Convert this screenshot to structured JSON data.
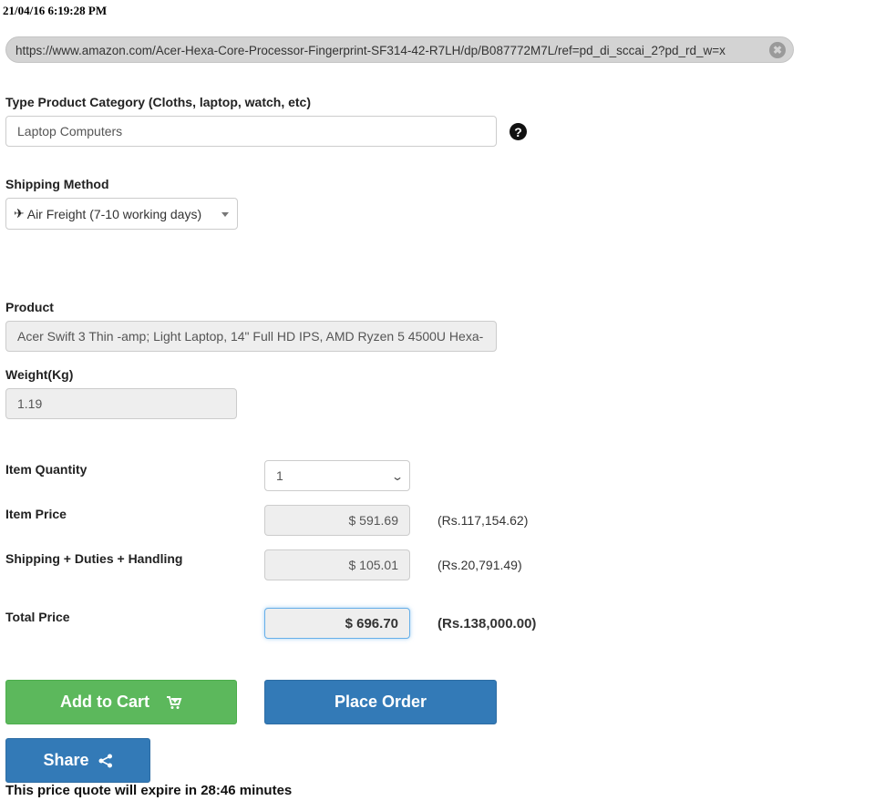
{
  "timestamp": "21/04/16 6:19:28 PM",
  "url": {
    "value": "https://www.amazon.com/Acer-Hexa-Core-Processor-Fingerprint-SF314-42-R7LH/dp/B087772M7L/ref=pd_di_sccai_2?pd_rd_w=x",
    "clear_icon": "✖"
  },
  "category": {
    "label": "Type Product Category (Cloths, laptop, watch, etc)",
    "value": "Laptop Computers",
    "help_icon": "?"
  },
  "shipping": {
    "label": "Shipping Method",
    "icon": "✈",
    "value": "Air Freight (7-10 working days)"
  },
  "product": {
    "label": "Product",
    "value": "Acer Swift 3 Thin -amp; Light Laptop, 14\" Full HD IPS, AMD Ryzen 5 4500U Hexa-"
  },
  "weight": {
    "label": "Weight(Kg)",
    "value": "1.19"
  },
  "quantity": {
    "label": "Item Quantity",
    "value": "1"
  },
  "item_price": {
    "label": "Item Price",
    "usd": "$ 591.69",
    "lkr": "(Rs.117,154.62)"
  },
  "shipping_cost": {
    "label": "Shipping + Duties + Handling",
    "usd": "$ 105.01",
    "lkr": "(Rs.20,791.49)"
  },
  "total": {
    "label": "Total Price",
    "usd": "$ 696.70",
    "lkr": "(Rs.138,000.00)"
  },
  "buttons": {
    "add_to_cart": "Add to Cart",
    "place_order": "Place Order",
    "share": "Share"
  },
  "expiry_notice": "This price quote will expire in 28:46 minutes",
  "colors": {
    "green": "#5cb85c",
    "blue": "#337ab7"
  }
}
